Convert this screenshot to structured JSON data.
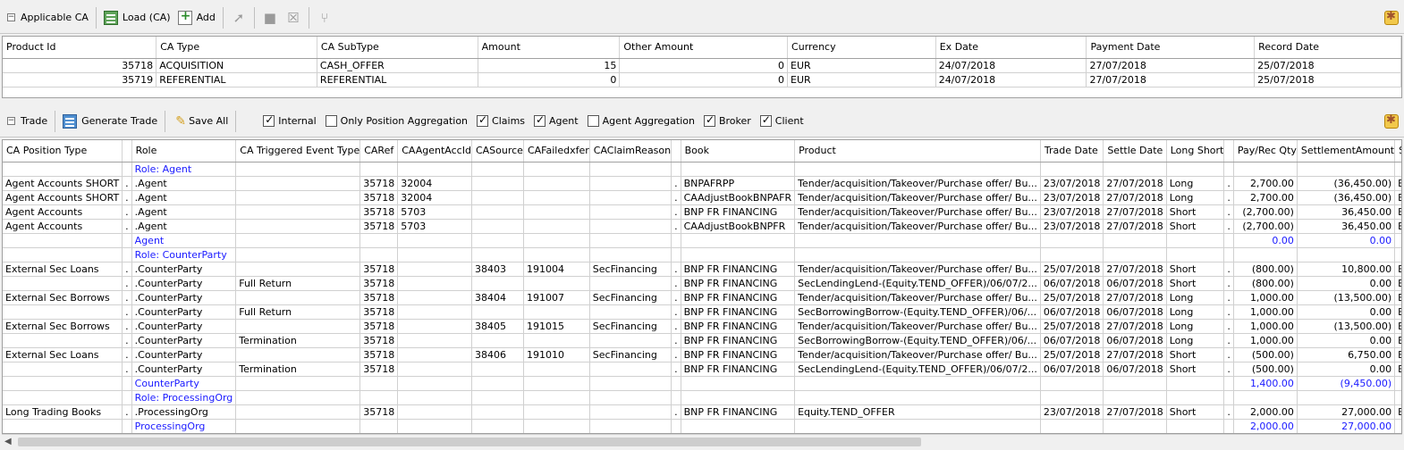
{
  "top_toolbar": {
    "collapse_symbol": "−",
    "section_label": "Applicable CA",
    "load_label": "Load (CA)",
    "add_label": "Add"
  },
  "ca_table": {
    "headers": [
      "Product Id",
      "CA Type",
      "CA SubType",
      "Amount",
      "Other Amount",
      "Currency",
      "Ex Date",
      "Payment Date",
      "Record Date"
    ],
    "rows": [
      [
        "35718",
        "ACQUISITION",
        "CASH_OFFER",
        "15",
        "0",
        "EUR",
        "24/07/2018",
        "27/07/2018",
        "25/07/2018"
      ],
      [
        "35719",
        "REFERENTIAL",
        "REFERENTIAL",
        "0",
        "0",
        "EUR",
        "24/07/2018",
        "27/07/2018",
        "25/07/2018"
      ]
    ]
  },
  "trade_toolbar": {
    "collapse_symbol": "−",
    "section_label": "Trade",
    "generate_label": "Generate Trade",
    "save_all_label": "Save All",
    "checkboxes": [
      {
        "label": "Internal",
        "checked": true
      },
      {
        "label": "Only Position Aggregation",
        "checked": false
      },
      {
        "label": "Claims",
        "checked": true
      },
      {
        "label": "Agent",
        "checked": true
      },
      {
        "label": "Agent Aggregation",
        "checked": false
      },
      {
        "label": "Broker",
        "checked": true
      },
      {
        "label": "Client",
        "checked": true
      }
    ]
  },
  "trade_table": {
    "headers": [
      "CA Position Type",
      "",
      "Role",
      "CA Triggered Event Type",
      "CARef",
      "CAAgentAccId",
      "CASource",
      "CAFailedxfer",
      "CAClaimReason",
      "",
      "Book",
      "Product",
      "Trade Date",
      "Settle Date",
      "Long Short",
      "",
      "Pay/Rec Qty",
      "SettlementAmount",
      "Settle C"
    ],
    "rows": [
      {
        "kind": "group",
        "cells": [
          "",
          "",
          "Role: Agent",
          "",
          "",
          "",
          "",
          "",
          "",
          "",
          "",
          "",
          "",
          "",
          "",
          "",
          "",
          "",
          ""
        ]
      },
      {
        "kind": "data",
        "cells": [
          "Agent Accounts SHORT",
          ".",
          ".Agent",
          "",
          "35718",
          "32004",
          "",
          "",
          "",
          ".",
          "BNPAFRPP",
          "Tender/acquisition/Takeover/Purchase offer/ Bu...",
          "23/07/2018",
          "27/07/2018",
          "Long",
          ".",
          "2,700.00",
          "(36,450.00)",
          "EUR"
        ]
      },
      {
        "kind": "data",
        "cells": [
          "Agent Accounts SHORT",
          ".",
          ".Agent",
          "",
          "35718",
          "32004",
          "",
          "",
          "",
          ".",
          "CAAdjustBookBNPAFR",
          "Tender/acquisition/Takeover/Purchase offer/ Bu...",
          "23/07/2018",
          "27/07/2018",
          "Long",
          ".",
          "2,700.00",
          "(36,450.00)",
          "EUR"
        ]
      },
      {
        "kind": "data",
        "cells": [
          "Agent Accounts",
          ".",
          ".Agent",
          "",
          "35718",
          "5703",
          "",
          "",
          "",
          ".",
          "BNP FR FINANCING",
          "Tender/acquisition/Takeover/Purchase offer/ Bu...",
          "23/07/2018",
          "27/07/2018",
          "Short",
          ".",
          "(2,700.00)",
          "36,450.00",
          "EUR"
        ]
      },
      {
        "kind": "data",
        "cells": [
          "Agent Accounts",
          ".",
          ".Agent",
          "",
          "35718",
          "5703",
          "",
          "",
          "",
          ".",
          "CAAdjustBookBNPFR",
          "Tender/acquisition/Takeover/Purchase offer/ Bu...",
          "23/07/2018",
          "27/07/2018",
          "Short",
          ".",
          "(2,700.00)",
          "36,450.00",
          "EUR"
        ]
      },
      {
        "kind": "total",
        "cells": [
          "",
          "",
          "Agent",
          "",
          "",
          "",
          "",
          "",
          "",
          "",
          "",
          "",
          "",
          "",
          "",
          "",
          "0.00",
          "0.00",
          ""
        ]
      },
      {
        "kind": "group",
        "cells": [
          "",
          "",
          "Role: CounterParty",
          "",
          "",
          "",
          "",
          "",
          "",
          "",
          "",
          "",
          "",
          "",
          "",
          "",
          "",
          "",
          ""
        ]
      },
      {
        "kind": "data",
        "cells": [
          "External Sec Loans",
          ".",
          ".CounterParty",
          "",
          "35718",
          "",
          "38403",
          "191004",
          "SecFinancing",
          ".",
          "BNP FR FINANCING",
          "Tender/acquisition/Takeover/Purchase offer/ Bu...",
          "25/07/2018",
          "27/07/2018",
          "Short",
          ".",
          "(800.00)",
          "10,800.00",
          "EUR"
        ]
      },
      {
        "kind": "data",
        "cells": [
          "",
          ".",
          ".CounterParty",
          "Full Return",
          "35718",
          "",
          "",
          "",
          "",
          ".",
          "BNP FR FINANCING",
          "SecLendingLend-(Equity.TEND_OFFER)/06/07/2...",
          "06/07/2018",
          "06/07/2018",
          "Short",
          ".",
          "(800.00)",
          "0.00",
          "EUR"
        ]
      },
      {
        "kind": "data",
        "cells": [
          "External Sec Borrows",
          ".",
          ".CounterParty",
          "",
          "35718",
          "",
          "38404",
          "191007",
          "SecFinancing",
          ".",
          "BNP FR FINANCING",
          "Tender/acquisition/Takeover/Purchase offer/ Bu...",
          "25/07/2018",
          "27/07/2018",
          "Long",
          ".",
          "1,000.00",
          "(13,500.00)",
          "EUR"
        ]
      },
      {
        "kind": "data",
        "cells": [
          "",
          ".",
          ".CounterParty",
          "Full Return",
          "35718",
          "",
          "",
          "",
          "",
          ".",
          "BNP FR FINANCING",
          "SecBorrowingBorrow-(Equity.TEND_OFFER)/06/...",
          "06/07/2018",
          "06/07/2018",
          "Long",
          ".",
          "1,000.00",
          "0.00",
          "EUR"
        ]
      },
      {
        "kind": "data",
        "cells": [
          "External Sec Borrows",
          ".",
          ".CounterParty",
          "",
          "35718",
          "",
          "38405",
          "191015",
          "SecFinancing",
          ".",
          "BNP FR FINANCING",
          "Tender/acquisition/Takeover/Purchase offer/ Bu...",
          "25/07/2018",
          "27/07/2018",
          "Long",
          ".",
          "1,000.00",
          "(13,500.00)",
          "EUR"
        ]
      },
      {
        "kind": "data",
        "cells": [
          "",
          ".",
          ".CounterParty",
          "Termination",
          "35718",
          "",
          "",
          "",
          "",
          ".",
          "BNP FR FINANCING",
          "SecBorrowingBorrow-(Equity.TEND_OFFER)/06/...",
          "06/07/2018",
          "06/07/2018",
          "Long",
          ".",
          "1,000.00",
          "0.00",
          "EUR"
        ]
      },
      {
        "kind": "data",
        "cells": [
          "External Sec Loans",
          ".",
          ".CounterParty",
          "",
          "35718",
          "",
          "38406",
          "191010",
          "SecFinancing",
          ".",
          "BNP FR FINANCING",
          "Tender/acquisition/Takeover/Purchase offer/ Bu...",
          "25/07/2018",
          "27/07/2018",
          "Short",
          ".",
          "(500.00)",
          "6,750.00",
          "EUR"
        ]
      },
      {
        "kind": "data",
        "cells": [
          "",
          ".",
          ".CounterParty",
          "Termination",
          "35718",
          "",
          "",
          "",
          "",
          ".",
          "BNP FR FINANCING",
          "SecLendingLend-(Equity.TEND_OFFER)/06/07/2...",
          "06/07/2018",
          "06/07/2018",
          "Short",
          ".",
          "(500.00)",
          "0.00",
          "EUR"
        ]
      },
      {
        "kind": "total",
        "cells": [
          "",
          "",
          "CounterParty",
          "",
          "",
          "",
          "",
          "",
          "",
          "",
          "",
          "",
          "",
          "",
          "",
          "",
          "1,400.00",
          "(9,450.00)",
          ""
        ]
      },
      {
        "kind": "group",
        "cells": [
          "",
          "",
          "Role: ProcessingOrg",
          "",
          "",
          "",
          "",
          "",
          "",
          "",
          "",
          "",
          "",
          "",
          "",
          "",
          "",
          "",
          ""
        ]
      },
      {
        "kind": "data",
        "cells": [
          "Long Trading Books",
          ".",
          ".ProcessingOrg",
          "",
          "35718",
          "",
          "",
          "",
          "",
          ".",
          "BNP FR FINANCING",
          "Equity.TEND_OFFER",
          "23/07/2018",
          "27/07/2018",
          "Short",
          ".",
          "2,000.00",
          "27,000.00",
          "EUR"
        ]
      },
      {
        "kind": "total",
        "cells": [
          "",
          "",
          "ProcessingOrg",
          "",
          "",
          "",
          "",
          "",
          "",
          "",
          "",
          "",
          "",
          "",
          "",
          "",
          "2,000.00",
          "27,000.00",
          ""
        ]
      }
    ]
  }
}
